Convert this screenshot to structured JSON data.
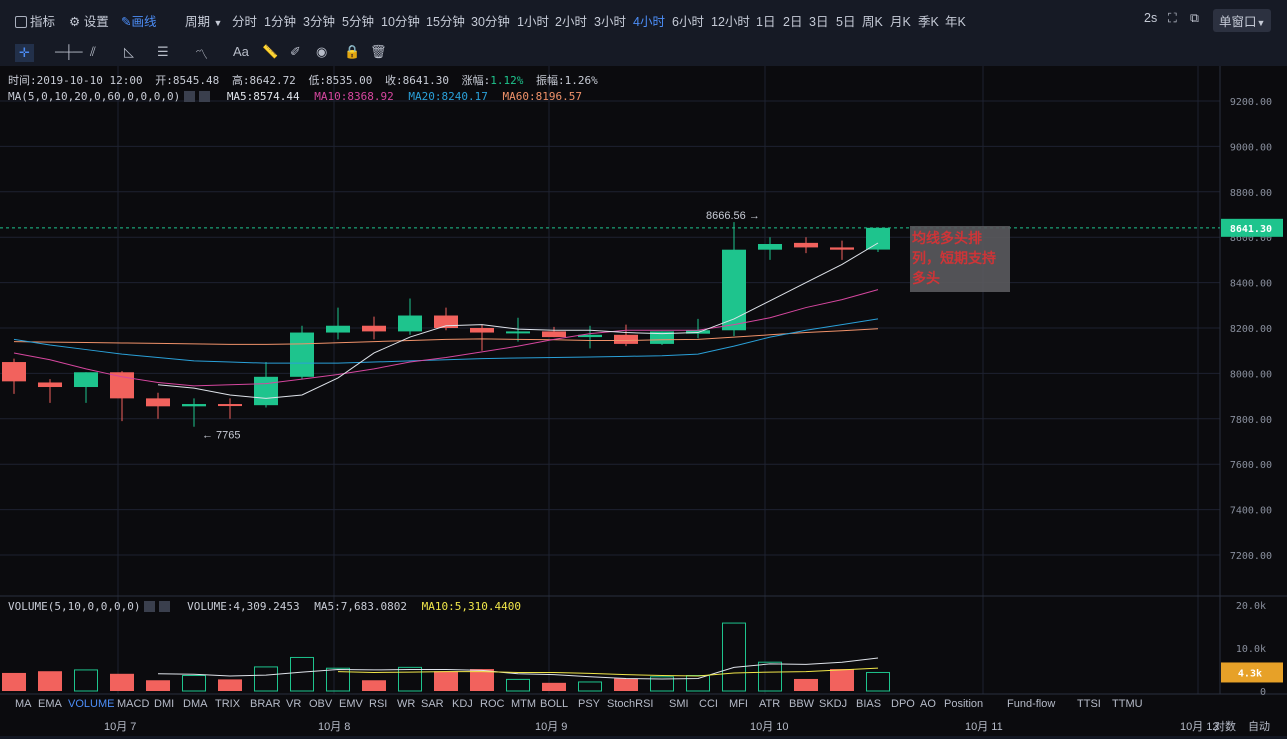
{
  "toolbar": {
    "indicators": "指标",
    "settings": "设置",
    "draw": "画线",
    "period": "周期",
    "periods": [
      "分时",
      "1分钟",
      "3分钟",
      "5分钟",
      "10分钟",
      "15分钟",
      "30分钟",
      "1小时",
      "2小时",
      "3小时",
      "4小时",
      "6小时",
      "12小时",
      "1日",
      "2日",
      "3日",
      "5日",
      "周K",
      "月K",
      "季K",
      "年K"
    ],
    "active_period": "4小时",
    "refresh": "2s",
    "window_mode": "单窗口"
  },
  "drawing_tools": [
    "crosshair",
    "horizontal-line",
    "parallel-lines",
    "triangle",
    "channel",
    "wave",
    "text",
    "ruler",
    "brush",
    "visible",
    "lock",
    "delete"
  ],
  "drawing_text_label": "Aa",
  "info": {
    "time": "时间:2019-10-10 12:00",
    "open": "开:8545.48",
    "high": "高:8642.72",
    "low": "低:8535.00",
    "close": "收:8641.30",
    "change_label": "涨幅:",
    "change": "1.12%",
    "amplitude": "振幅:1.26%",
    "ma_params": "MA(5,0,10,20,0,60,0,0,0,0)",
    "ma5": "MA5:8574.44",
    "ma10": "MA10:8368.92",
    "ma20": "MA20:8240.17",
    "ma60": "MA60:8196.57",
    "vol_params": "VOLUME(5,10,0,0,0,0)",
    "volume": "VOLUME:4,309.2453",
    "vma5": "MA5:7,683.0802",
    "vma10": "MA10:5,310.4400"
  },
  "colors": {
    "up": "#1ec48d",
    "down": "#f2625d",
    "ma5": "#dfe3ea",
    "ma10": "#d6479f",
    "ma20": "#2aa0d8",
    "ma60": "#f0926a",
    "vma10": "#f0e64a",
    "annotation": "#e4393c"
  },
  "price_axis": [
    "9200.00",
    "9000.00",
    "8800.00",
    "8600.00",
    "8400.00",
    "8200.00",
    "8000.00",
    "7800.00",
    "7600.00",
    "7400.00",
    "7200.00"
  ],
  "last_price": "8641.30",
  "volume_axis": [
    "20.0k",
    "10.0k",
    "0"
  ],
  "last_volume": "4.3k",
  "annotation": "均线多头排列，短期支持多头",
  "high_marker": "8666.56 →",
  "low_marker": "← 7765",
  "indicator_tabs": [
    "MA",
    "EMA",
    "VOLUME",
    "MACD",
    "DMI",
    "DMA",
    "TRIX",
    "BRAR",
    "VR",
    "OBV",
    "EMV",
    "RSI",
    "WR",
    "SAR",
    "KDJ",
    "ROC",
    "MTM",
    "BOLL",
    "PSY",
    "StochRSI",
    "SMI",
    "CCI",
    "MFI",
    "ATR",
    "BBW",
    "SKDJ",
    "BIAS",
    "DPO",
    "AO",
    "Position",
    "Fund-flow",
    "TTSI",
    "TTMU"
  ],
  "x_axis": [
    "10月 7",
    "10月 8",
    "10月 9",
    "10月 10",
    "10月 11",
    "10月 12"
  ],
  "scale_modes": [
    "对数",
    "自动"
  ],
  "chart_data": {
    "type": "candlestick",
    "ylim": [
      7100,
      9300
    ],
    "candles": [
      {
        "o": 8050,
        "h": 8065,
        "l": 7910,
        "c": 7965
      },
      {
        "o": 7960,
        "h": 7975,
        "l": 7870,
        "c": 7940
      },
      {
        "o": 7940,
        "h": 8005,
        "l": 7870,
        "c": 8005
      },
      {
        "o": 8005,
        "h": 8010,
        "l": 7790,
        "c": 7890
      },
      {
        "o": 7890,
        "h": 7915,
        "l": 7800,
        "c": 7855
      },
      {
        "o": 7855,
        "h": 7890,
        "l": 7765,
        "c": 7865
      },
      {
        "o": 7865,
        "h": 7890,
        "l": 7800,
        "c": 7860
      },
      {
        "o": 7860,
        "h": 8050,
        "l": 7850,
        "c": 7985
      },
      {
        "o": 7985,
        "h": 8210,
        "l": 7975,
        "c": 8180
      },
      {
        "o": 8180,
        "h": 8290,
        "l": 8150,
        "c": 8210
      },
      {
        "o": 8210,
        "h": 8250,
        "l": 8150,
        "c": 8185
      },
      {
        "o": 8185,
        "h": 8330,
        "l": 8170,
        "c": 8255
      },
      {
        "o": 8255,
        "h": 8290,
        "l": 8190,
        "c": 8200
      },
      {
        "o": 8200,
        "h": 8215,
        "l": 8100,
        "c": 8180
      },
      {
        "o": 8180,
        "h": 8245,
        "l": 8140,
        "c": 8185
      },
      {
        "o": 8185,
        "h": 8205,
        "l": 8160,
        "c": 8160
      },
      {
        "o": 8160,
        "h": 8210,
        "l": 8110,
        "c": 8170
      },
      {
        "o": 8170,
        "h": 8215,
        "l": 8120,
        "c": 8130
      },
      {
        "o": 8130,
        "h": 8185,
        "l": 8125,
        "c": 8185
      },
      {
        "o": 8175,
        "h": 8240,
        "l": 8155,
        "c": 8190
      },
      {
        "o": 8190,
        "h": 8666.56,
        "l": 8165,
        "c": 8545
      },
      {
        "o": 8545,
        "h": 8600,
        "l": 8500,
        "c": 8570
      },
      {
        "o": 8575,
        "h": 8600,
        "l": 8530,
        "c": 8555
      },
      {
        "o": 8555,
        "h": 8585,
        "l": 8500,
        "c": 8545
      },
      {
        "o": 8545.48,
        "h": 8642.72,
        "l": 8535,
        "c": 8641.3
      }
    ],
    "ma5": [
      null,
      null,
      null,
      null,
      7950,
      7935,
      7905,
      7890,
      7905,
      7980,
      8090,
      8160,
      8210,
      8215,
      8195,
      8190,
      8190,
      8180,
      8175,
      8180,
      8240,
      8320,
      8400,
      8480,
      8574.44
    ],
    "ma10": [
      8090,
      8060,
      8020,
      7985,
      7960,
      7945,
      7950,
      7955,
      7975,
      7995,
      8020,
      8050,
      8070,
      8095,
      8120,
      8150,
      8175,
      8190,
      8190,
      8190,
      8215,
      8245,
      8290,
      8325,
      8368.92
    ],
    "ma20": [
      8150,
      8125,
      8105,
      8085,
      8070,
      8055,
      8050,
      8045,
      8045,
      8045,
      8050,
      8055,
      8060,
      8065,
      8068,
      8070,
      8072,
      8075,
      8078,
      8085,
      8120,
      8160,
      8190,
      8215,
      8240.17
    ],
    "ma60": [
      8140,
      8138,
      8136,
      8134,
      8132,
      8130,
      8128,
      8128,
      8130,
      8135,
      8140,
      8145,
      8150,
      8152,
      8150,
      8148,
      8145,
      8145,
      8148,
      8150,
      8160,
      8170,
      8180,
      8188,
      8196.57
    ],
    "volume": [
      4200,
      4600,
      4900,
      4000,
      2500,
      3600,
      2700,
      5600,
      7800,
      5300,
      2500,
      5500,
      4600,
      5100,
      2700,
      1900,
      2100,
      2900,
      3300,
      3600,
      15800,
      6700,
      2800,
      5100,
      4309.2453
    ],
    "vol_ma5": [
      null,
      null,
      null,
      null,
      4000,
      3900,
      3500,
      3700,
      4400,
      5000,
      4900,
      5000,
      5000,
      4800,
      4000,
      3800,
      3300,
      2900,
      2800,
      2900,
      5500,
      6300,
      6200,
      6700,
      7683.0802
    ],
    "vol_ma10": [
      null,
      null,
      null,
      null,
      null,
      null,
      null,
      null,
      null,
      4500,
      4300,
      4400,
      4500,
      4500,
      4300,
      4300,
      4100,
      3800,
      3600,
      3500,
      4200,
      4400,
      4500,
      4900,
      5310.44
    ]
  }
}
